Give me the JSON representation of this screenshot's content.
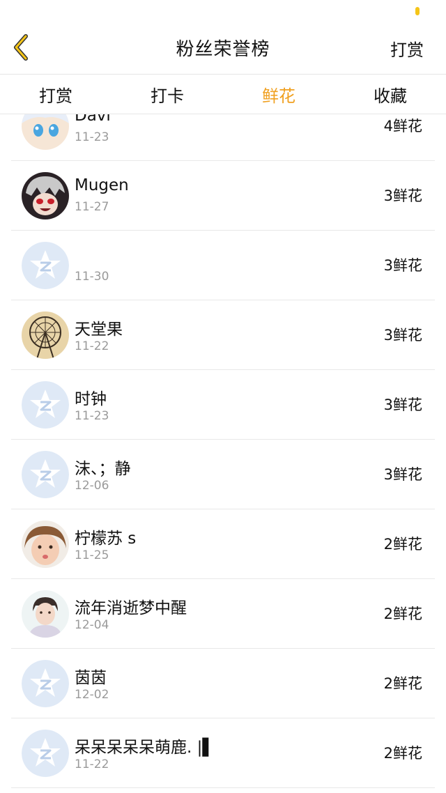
{
  "nav": {
    "title": "粉丝荣誉榜",
    "right_label": "打赏",
    "back_icon": "chevron-left-icon",
    "accent": "#f5c518"
  },
  "tabs": [
    {
      "label": "打赏",
      "active": false
    },
    {
      "label": "打卡",
      "active": false
    },
    {
      "label": "鲜花",
      "active": true
    },
    {
      "label": "收藏",
      "active": false
    }
  ],
  "active_color": "#f0a020",
  "rows": [
    {
      "name": "Davi",
      "date": "11-23",
      "count": "4鲜花",
      "avatar": "anime-girl-avatar"
    },
    {
      "name": "Mugen",
      "date": "11-27",
      "count": "3鲜花",
      "avatar": "anime-character-avatar"
    },
    {
      "name": "",
      "date": "11-30",
      "count": "3鲜花",
      "avatar": "default-avatar"
    },
    {
      "name": "天堂果",
      "date": "11-22",
      "count": "3鲜花",
      "avatar": "ferris-wheel-avatar"
    },
    {
      "name": "时钟",
      "date": "11-23",
      "count": "3鲜花",
      "avatar": "default-avatar"
    },
    {
      "name": "沫、；静",
      "date": "12-06",
      "count": "3鲜花",
      "avatar": "default-avatar"
    },
    {
      "name": "柠檬苏 s",
      "date": "11-25",
      "count": "2鲜花",
      "avatar": "child-photo-avatar"
    },
    {
      "name": "流年消逝梦中醒",
      "date": "12-04",
      "count": "2鲜花",
      "avatar": "person-photo-avatar"
    },
    {
      "name": "茵茵",
      "date": "12-02",
      "count": "2鲜花",
      "avatar": "default-avatar"
    },
    {
      "name": "呆呆呆呆呆萌鹿. |▌",
      "date": "11-22",
      "count": "2鲜花",
      "avatar": "default-avatar"
    }
  ]
}
